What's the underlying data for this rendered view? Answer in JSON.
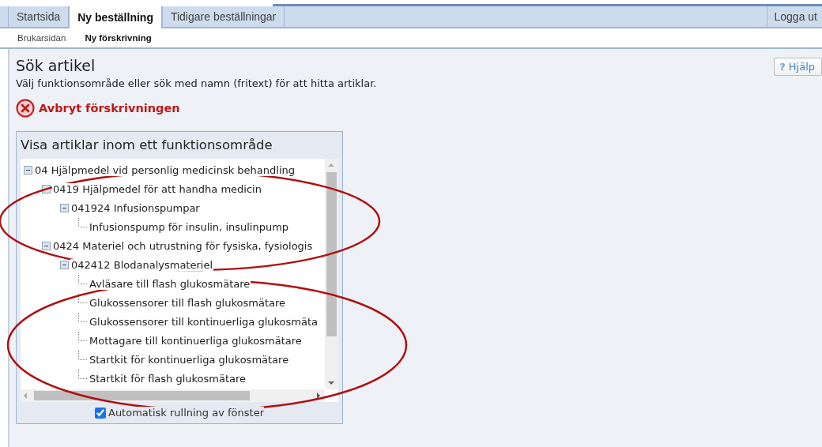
{
  "tabs": [
    {
      "label": "Startsida",
      "selected": false
    },
    {
      "label": "Ny beställning",
      "selected": true
    },
    {
      "label": "Tidigare beställningar",
      "selected": false
    }
  ],
  "logout": {
    "label": "Logga ut"
  },
  "breadcrumbs": [
    {
      "label": "Brukarsidan",
      "selected": false
    },
    {
      "label": "Ny förskrivning",
      "selected": true
    }
  ],
  "page": {
    "title": "Sök artikel",
    "description": "Välj funktionsområde eller sök med namn (fritext) för att hitta artiklar.",
    "help_button": {
      "icon": "?",
      "label": "Hjälp"
    },
    "cancel_link": "Avbryt förskrivningen"
  },
  "panel": {
    "title": "Visa artiklar inom ett funktionsområde",
    "tree": [
      {
        "label": "04 Hjälpmedel vid personlig medicinsk behandling",
        "expanded": true,
        "children": [
          {
            "label": "0419 Hjälpmedel för att handha medicin",
            "expanded": true,
            "children": [
              {
                "label": "041924 Infusionspumpar",
                "expanded": true,
                "children": [
                  {
                    "label": "Infusionspump för insulin, insulinpump"
                  }
                ]
              }
            ]
          },
          {
            "label": "0424 Materiel och utrustning för fysiska, fysiologis",
            "expanded": true,
            "children": [
              {
                "label": "042412 Blodanalysmateriel",
                "expanded": true,
                "children": [
                  {
                    "label": "Avläsare till flash glukosmätare"
                  },
                  {
                    "label": "Glukossensorer till flash glukosmätare"
                  },
                  {
                    "label": "Glukossensorer till kontinuerliga glukosmäta"
                  },
                  {
                    "label": "Mottagare till kontinuerliga glukosmätare"
                  },
                  {
                    "label": "Startkit för kontinuerliga glukosmätare"
                  },
                  {
                    "label": "Startkit för flash glukosmätare"
                  }
                ]
              }
            ]
          }
        ]
      }
    ],
    "auto_scroll": {
      "label": "Automatisk rullning av fönster",
      "checked": true
    }
  },
  "highlight_rings": [
    {
      "color": "#b01010"
    },
    {
      "color": "#b01010"
    }
  ]
}
